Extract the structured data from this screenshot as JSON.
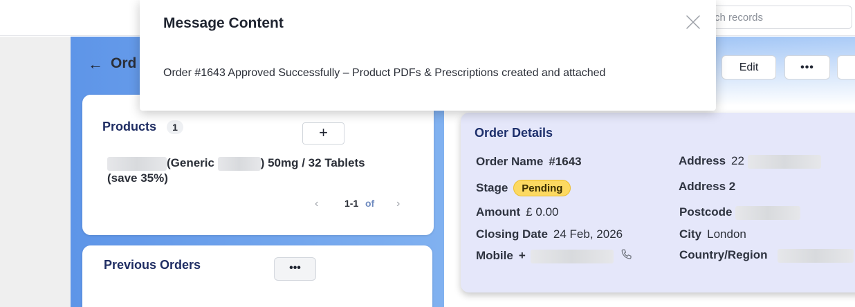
{
  "topbar": {
    "search_placeholder": "ch records"
  },
  "page": {
    "title": "Ord"
  },
  "header_buttons": {
    "edit_label": "Edit",
    "more_label": "•••"
  },
  "products": {
    "title": "Products",
    "count": "1",
    "add_label": "+",
    "item": {
      "generic_prefix": "(Generic",
      "suffix": ") 50mg / 32 Tablets",
      "save_note": "(save 35%)"
    },
    "pager": {
      "prev": "‹",
      "range": "1-1",
      "of": "of",
      "next": "›"
    }
  },
  "previous_orders": {
    "title": "Previous Orders",
    "more_label": "•••"
  },
  "order_details": {
    "title": "Order Details",
    "order_name_label": "Order Name",
    "order_name_value": "#1643",
    "stage_label": "Stage",
    "stage_value": "Pending",
    "amount_label": "Amount",
    "amount_value": "£ 0.00",
    "closing_date_label": "Closing Date",
    "closing_date_value": "24 Feb, 2026",
    "mobile_label": "Mobile",
    "mobile_value": "+",
    "address_label": "Address",
    "address_value": "22",
    "address2_label": "Address 2",
    "postcode_label": "Postcode",
    "city_label": "City",
    "city_value": "London",
    "country_label": "Country/Region"
  },
  "modal": {
    "title": "Message Content",
    "message": "Order #1643 Approved Successfully – Product PDFs & Prescriptions created and attached"
  },
  "colors": {
    "accent_blue": "#5e95e8",
    "title_navy": "#1f2d63",
    "stage_pending": "#fcd961",
    "details_bg": "#e5e7fa"
  },
  "icons": {
    "back": "back-arrow-icon",
    "close": "close-icon",
    "phone": "phone-icon"
  }
}
